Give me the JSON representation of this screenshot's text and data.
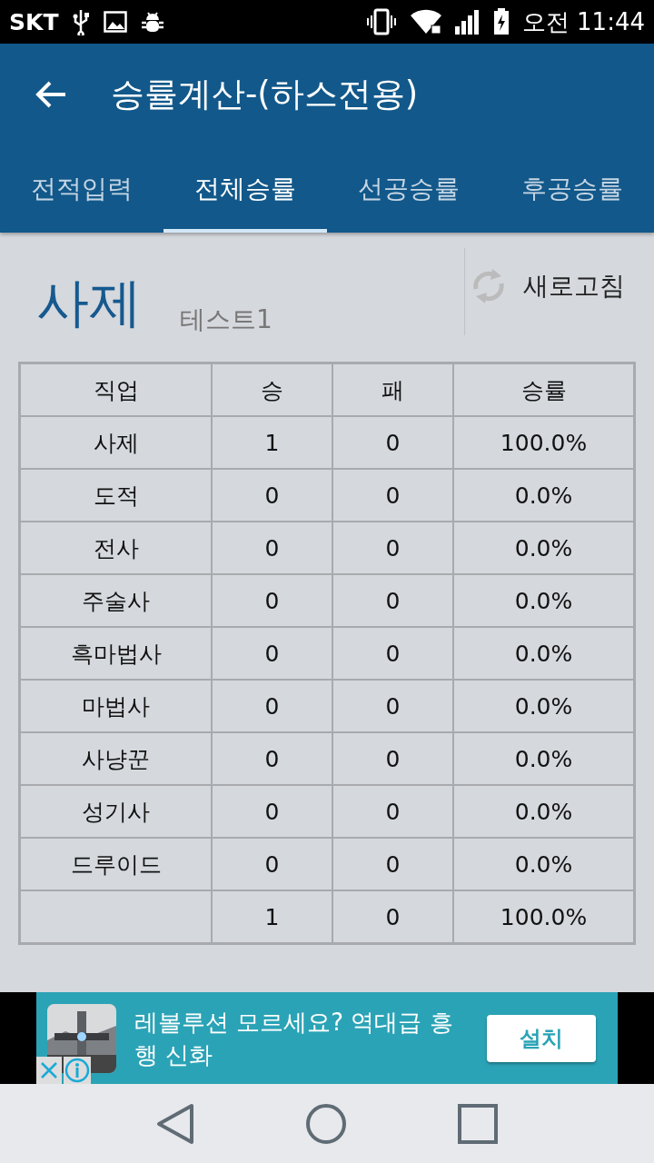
{
  "status_bar": {
    "carrier": "SKT",
    "clock": "오전 11:44"
  },
  "toolbar": {
    "title": "승률계산-(하스전용)"
  },
  "tabs": [
    {
      "label": "전적입력",
      "selected": false
    },
    {
      "label": "전체승률",
      "selected": true
    },
    {
      "label": "선공승률",
      "selected": false
    },
    {
      "label": "후공승률",
      "selected": false
    }
  ],
  "header": {
    "class_name": "사제",
    "deck_name": "테스트1",
    "refresh_label": "새로고침"
  },
  "table": {
    "columns": [
      "직업",
      "승",
      "패",
      "승률"
    ],
    "rows": [
      [
        "사제",
        "1",
        "0",
        "100.0%"
      ],
      [
        "도적",
        "0",
        "0",
        "0.0%"
      ],
      [
        "전사",
        "0",
        "0",
        "0.0%"
      ],
      [
        "주술사",
        "0",
        "0",
        "0.0%"
      ],
      [
        "흑마법사",
        "0",
        "0",
        "0.0%"
      ],
      [
        "마법사",
        "0",
        "0",
        "0.0%"
      ],
      [
        "사냥꾼",
        "0",
        "0",
        "0.0%"
      ],
      [
        "성기사",
        "0",
        "0",
        "0.0%"
      ],
      [
        "드루이드",
        "0",
        "0",
        "0.0%"
      ]
    ],
    "total": {
      "wins": "1",
      "losses": "0",
      "rate": "100.0%"
    }
  },
  "ad": {
    "text": "레볼루션 모르세요? 역대급 흥행 신화",
    "button": "설치"
  }
}
